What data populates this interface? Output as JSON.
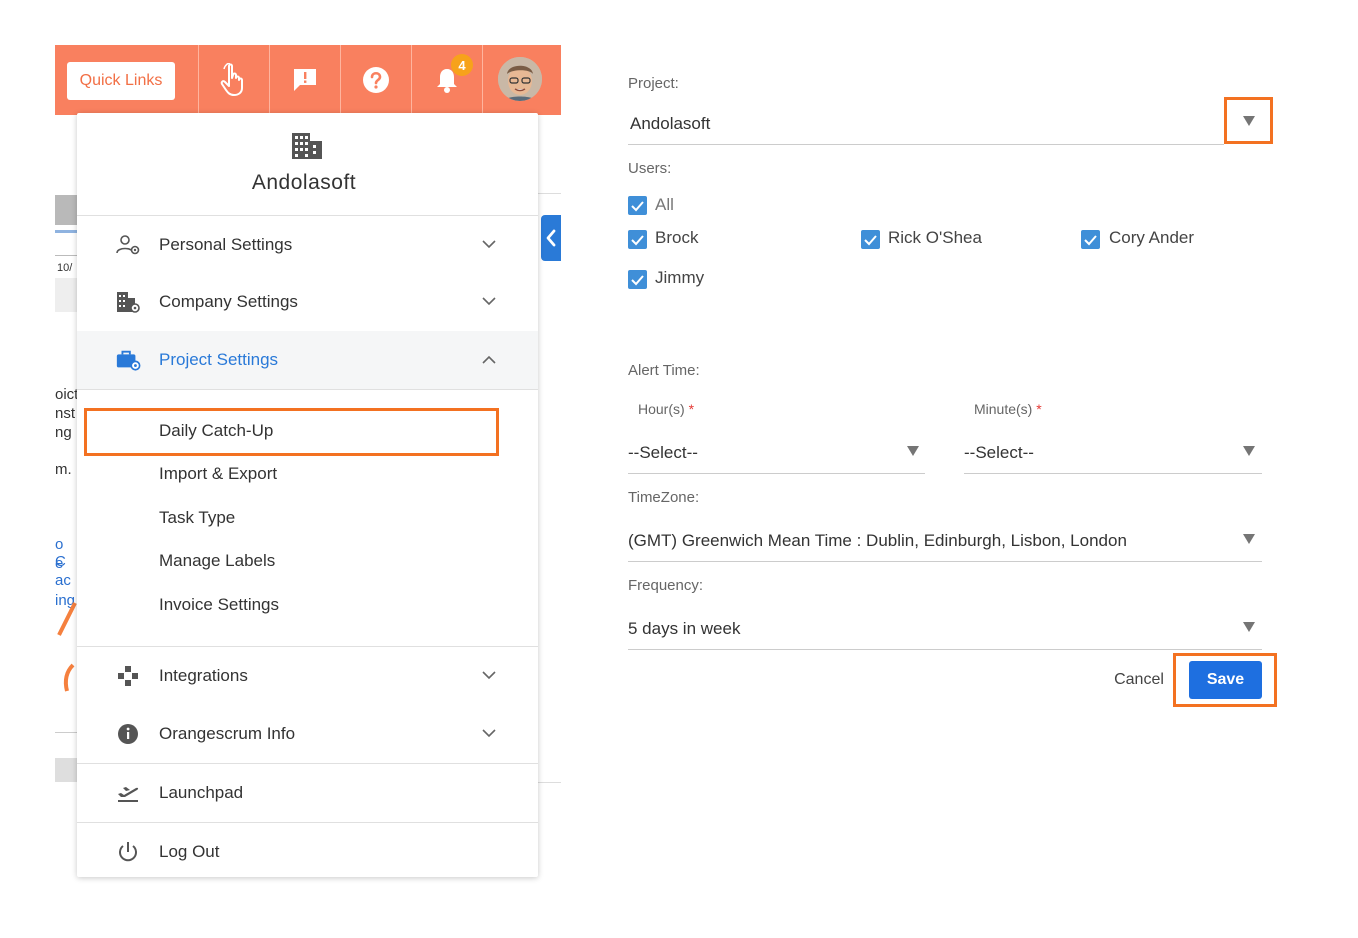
{
  "topbar": {
    "quick_links_label": "Quick Links",
    "notification_count": "4",
    "brand_color": "#f9805f"
  },
  "menu": {
    "company_name": "Andolasoft",
    "items": [
      {
        "label": "Personal Settings",
        "icon": "user-settings-icon"
      },
      {
        "label": "Company Settings",
        "icon": "building-settings-icon"
      },
      {
        "label": "Project Settings",
        "icon": "briefcase-settings-icon"
      }
    ],
    "project_sub_items": [
      "Daily Catch-Up",
      "Import & Export",
      "Task Type",
      "Manage Labels",
      "Invoice Settings"
    ],
    "lower_items": [
      {
        "label": "Integrations",
        "icon": "gamepad-icon"
      },
      {
        "label": "Orangescrum Info",
        "icon": "info-icon"
      },
      {
        "label": "Launchpad",
        "icon": "plane-takeoff-icon"
      },
      {
        "label": "Log Out",
        "icon": "power-icon"
      }
    ],
    "active_color": "#2979d8"
  },
  "background_fragments": {
    "date": "10/",
    "lines": [
      "oict",
      "nst",
      "ng",
      "m.",
      "o C",
      "e ac",
      "ing"
    ]
  },
  "form": {
    "project_label": "Project:",
    "project_value": "Andolasoft",
    "users_label": "Users:",
    "users": [
      "All",
      "Brock",
      "Rick O'Shea",
      "Cory Ander",
      "Jimmy"
    ],
    "alert_time_label": "Alert Time:",
    "hours_label": "Hour(s)",
    "minutes_label": "Minute(s)",
    "required_mark": "*",
    "hours_value": "--Select--",
    "minutes_value": "--Select--",
    "timezone_label": "TimeZone:",
    "timezone_value": "(GMT) Greenwich Mean Time : Dublin, Edinburgh, Lisbon, London",
    "frequency_label": "Frequency:",
    "frequency_value": "5 days in week",
    "cancel_label": "Cancel",
    "save_label": "Save",
    "highlight_color": "#f37121",
    "save_color": "#1e6fe0"
  }
}
